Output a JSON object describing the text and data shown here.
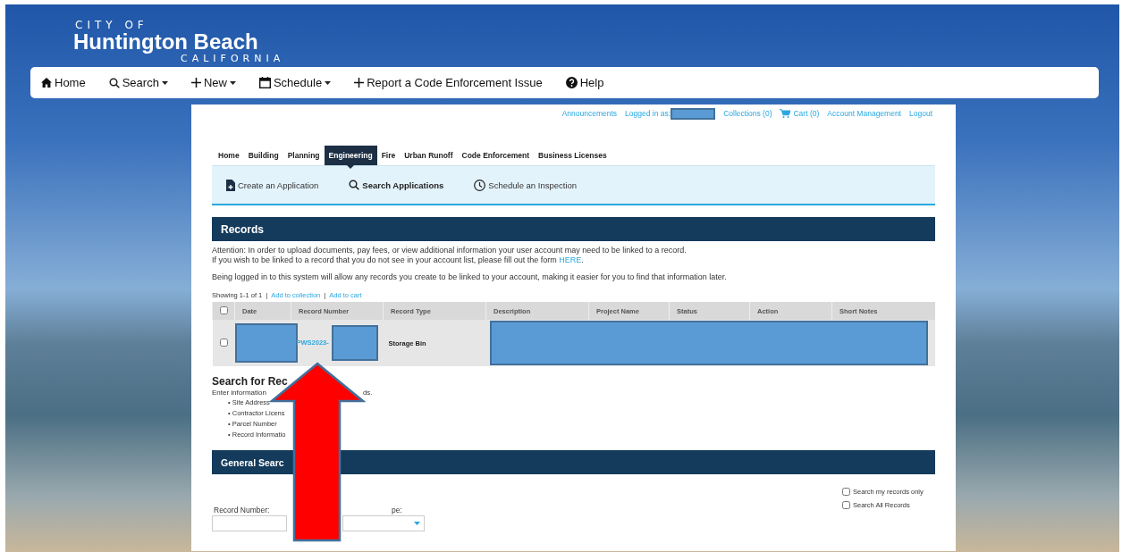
{
  "logo": {
    "line1": "CITY OF",
    "line2": "Huntington Beach",
    "line3": "CALIFORNIA"
  },
  "nav": [
    {
      "label": "Home",
      "kind": "home",
      "dropdown": false
    },
    {
      "label": "Search",
      "kind": "search",
      "dropdown": true
    },
    {
      "label": "New",
      "kind": "plus",
      "dropdown": true
    },
    {
      "label": "Schedule",
      "kind": "calendar",
      "dropdown": true
    },
    {
      "label": "Report a Code Enforcement Issue",
      "kind": "plus",
      "dropdown": false
    },
    {
      "label": "Help",
      "kind": "help",
      "dropdown": false
    }
  ],
  "top_links": {
    "announcements": "Announcements",
    "logged_in": "Logged in as:",
    "collections": "Collections (0)",
    "cart": "Cart (0)",
    "account": "Account Management",
    "logout": "Logout"
  },
  "tabs": [
    {
      "label": "Home",
      "selected": false
    },
    {
      "label": "Building",
      "selected": false
    },
    {
      "label": "Planning",
      "selected": false
    },
    {
      "label": "Engineering",
      "selected": true
    },
    {
      "label": "Fire",
      "selected": false
    },
    {
      "label": "Urban Runoff",
      "selected": false
    },
    {
      "label": "Code Enforcement",
      "selected": false
    },
    {
      "label": "Business Licenses",
      "selected": false
    }
  ],
  "subnav": [
    {
      "label": "Create an Application",
      "kind": "document",
      "selected": false
    },
    {
      "label": "Search Applications",
      "kind": "search",
      "selected": true
    },
    {
      "label": "Schedule an Inspection",
      "kind": "clock",
      "selected": false
    }
  ],
  "records": {
    "title": "Records",
    "notice_1": "Attention: In order to upload documents, pay fees, or view additional information your user account may need to be linked to a record.",
    "notice_2": "If you wish to be linked to a record that you do not see in your account list, please fill out the form",
    "notice_2_link": "HERE",
    "notice_2_end": ".",
    "notice_3": "Being logged in to this system will allow any records you create to be linked to your account, making it easier for you to find that information later.",
    "showing": "Showing 1-1 of 1",
    "separator_1": "|",
    "add_collection": "Add to collection",
    "separator_2": "|",
    "add_cart": "Add to cart",
    "select_all_checked": false,
    "columns": [
      "Date",
      "Record Number",
      "Record Type",
      "Description",
      "Project Name",
      "Status",
      "Action",
      "Short Notes"
    ],
    "rows": [
      {
        "checked": false,
        "record_number": "PWS2023-",
        "record_type": "Storage Bin"
      }
    ]
  },
  "search_section": {
    "title": "Search for Rec",
    "intro_start": "Enter information",
    "intro_end": "ds.",
    "bullets": [
      "• Site Address",
      "• Contractor Licens",
      "• Parcel Number",
      "• Record Informatio"
    ]
  },
  "general_search": {
    "title": "General Searc",
    "options": [
      {
        "label": "Search my records only",
        "checked": false
      },
      {
        "label": "Search All Records",
        "checked": false
      }
    ],
    "record_number_label": "Record Number:",
    "record_type_label": "pe:"
  }
}
